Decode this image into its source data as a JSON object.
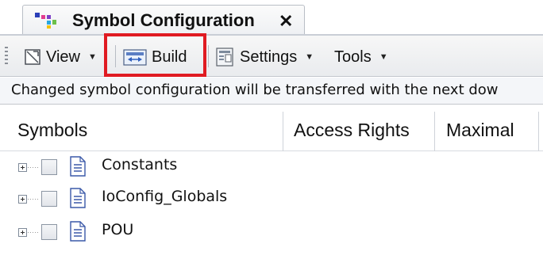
{
  "tab": {
    "title": "Symbol Configuration",
    "close_glyph": "✕",
    "icon": "symbol-config-icon"
  },
  "toolbar": {
    "view_label": "View",
    "build_label": "Build",
    "settings_label": "Settings",
    "tools_label": "Tools",
    "highlight_color": "#e01b22"
  },
  "info": {
    "message": "Changed symbol configuration will be transferred with the next dow"
  },
  "grid": {
    "columns": [
      "Symbols",
      "Access Rights",
      "Maximal"
    ]
  },
  "tree": {
    "items": [
      {
        "label": "Constants",
        "checked": false,
        "expanded": false
      },
      {
        "label": "IoConfig_Globals",
        "checked": false,
        "expanded": false
      },
      {
        "label": "POU",
        "checked": false,
        "expanded": false
      }
    ]
  }
}
